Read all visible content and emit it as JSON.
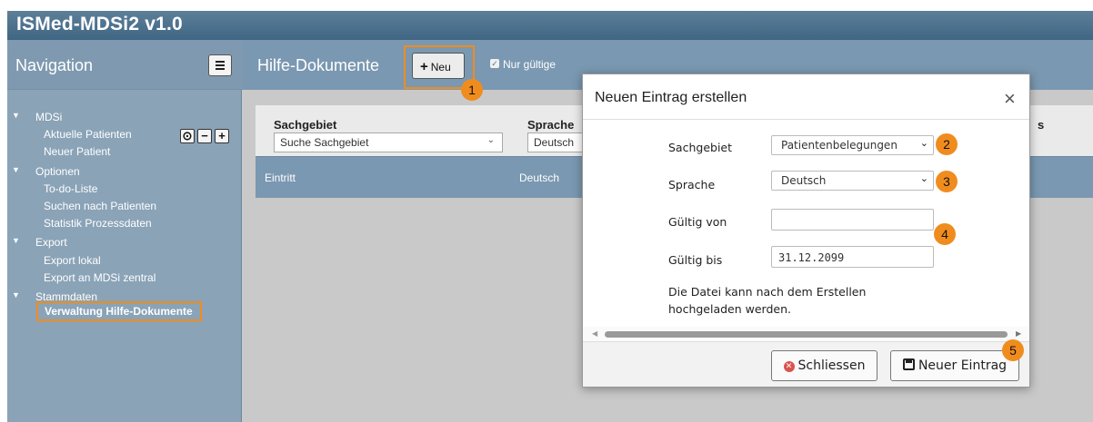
{
  "app": {
    "title": "ISMed-MDSi2 v1.0"
  },
  "sidebar": {
    "title": "Navigation",
    "groups": [
      {
        "label": "MDSi",
        "items": [
          "Aktuelle Patienten",
          "Neuer Patient"
        ]
      },
      {
        "label": "Optionen",
        "items": [
          "To-do-Liste",
          "Suchen nach Patienten",
          "Statistik Prozessdaten"
        ]
      },
      {
        "label": "Export",
        "items": [
          "Export lokal",
          "Export an MDSi zentral"
        ]
      },
      {
        "label": "Stammdaten",
        "items": [
          "Verwaltung Hilfe-Dokumente"
        ]
      }
    ],
    "tree_buttons": [
      "⊙",
      "−",
      "+"
    ]
  },
  "main": {
    "title": "Hilfe-Dokumente",
    "new_button": "Neu",
    "filter_checkbox": {
      "label": "Nur gültige",
      "checked": true
    },
    "filters": {
      "sachgebiet_label": "Sachgebiet",
      "sachgebiet_placeholder": "Suche Sachgebiet",
      "sprache_label": "Sprache",
      "sprache_value": "Deutsch",
      "truncated_label": "s"
    },
    "rows": [
      {
        "sachgebiet": "Eintritt",
        "sprache": "Deutsch"
      }
    ]
  },
  "modal": {
    "title": "Neuen Eintrag erstellen",
    "close_symbol": "×",
    "fields": {
      "sachgebiet_label": "Sachgebiet",
      "sachgebiet_value": "Patientenbelegungen",
      "sprache_label": "Sprache",
      "sprache_value": "Deutsch",
      "gueltig_von_label": "Gültig von",
      "gueltig_von_value": "",
      "gueltig_bis_label": "Gültig bis",
      "gueltig_bis_value": "31.12.2099"
    },
    "note_line1": "Die Datei kann nach dem Erstellen",
    "note_line2": "hochgeladen werden.",
    "close_button": "Schliessen",
    "submit_button": "Neuer Eintrag"
  },
  "callouts": [
    "1",
    "2",
    "3",
    "4",
    "5"
  ],
  "colors": {
    "accent": "#f08c1e",
    "header": "#4a6f8c",
    "sidebar": "#8aa3b7"
  }
}
